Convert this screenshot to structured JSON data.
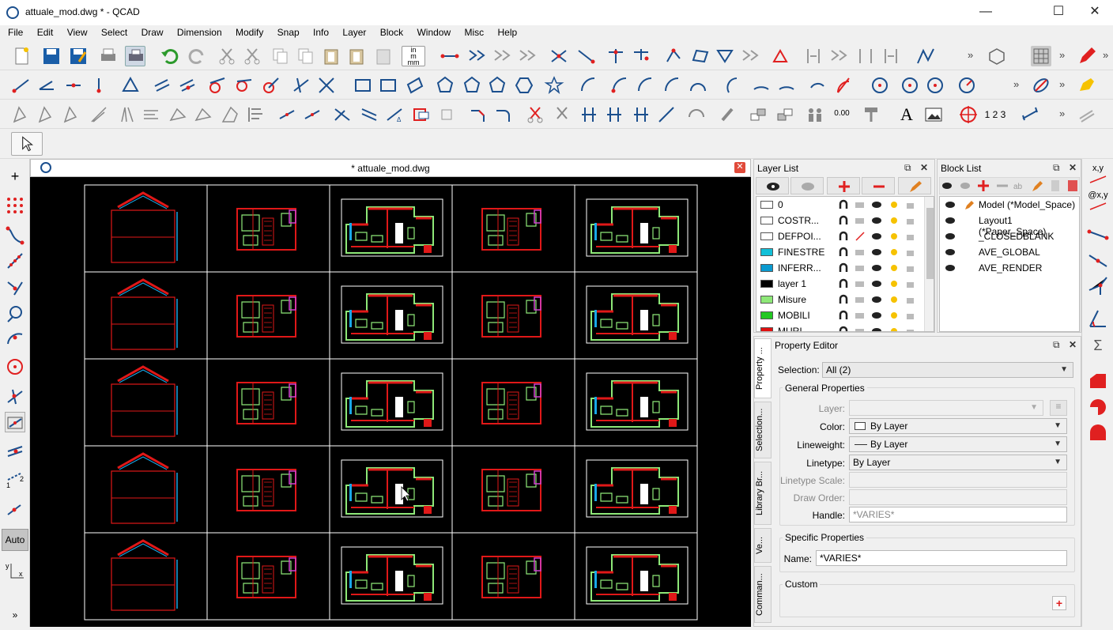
{
  "window": {
    "title": "attuale_mod.dwg * - QCAD",
    "minimize": "—",
    "maximize": "☐",
    "close": "✕"
  },
  "menu": [
    "File",
    "Edit",
    "View",
    "Select",
    "Draw",
    "Dimension",
    "Modify",
    "Snap",
    "Info",
    "Layer",
    "Block",
    "Window",
    "Misc",
    "Help"
  ],
  "document": {
    "title": "* attuale_mod.dwg",
    "close": "✕"
  },
  "left_tools": {
    "auto_label": "Auto"
  },
  "toolbar": {
    "unit_label": "in\nm\nmm",
    "dimension_value": "0.00",
    "text_tool": "A",
    "numbers_glyph": "1 2 3"
  },
  "layer_list": {
    "title": "Layer List",
    "layers": [
      {
        "name": "0",
        "color": "#ffffff"
      },
      {
        "name": "COSTR...",
        "color": "#ffffff"
      },
      {
        "name": "DEFPOI...",
        "color": "#ffffff"
      },
      {
        "name": "FINESTRE",
        "color": "#12c0d8"
      },
      {
        "name": "INFERR...",
        "color": "#0a9ad0"
      },
      {
        "name": "layer 1",
        "color": "#000000"
      },
      {
        "name": "Misure",
        "color": "#8ee878"
      },
      {
        "name": "MOBILI",
        "color": "#22c822"
      },
      {
        "name": "MURI",
        "color": "#e01010"
      }
    ]
  },
  "block_list": {
    "title": "Block List",
    "blocks": [
      "Model (*Model_Space)",
      "Layout1 (*Paper_Space)",
      "_CLOSEDBLANK",
      "AVE_GLOBAL",
      "AVE_RENDER"
    ]
  },
  "property_editor": {
    "title": "Property Editor",
    "tabs": [
      "Property ...",
      "Selection...",
      "Library Br...",
      "Ve...",
      "Comman..."
    ],
    "selection_label": "Selection:",
    "selection_value": "All (2)",
    "general_group": "General Properties",
    "layer_label": "Layer:",
    "layer_value": "",
    "color_label": "Color:",
    "color_value": "By Layer",
    "lineweight_label": "Lineweight:",
    "lineweight_value": "By Layer",
    "linetype_label": "Linetype:",
    "linetype_value": "By Layer",
    "linetype_scale_label": "Linetype Scale:",
    "draw_order_label": "Draw Order:",
    "handle_label": "Handle:",
    "handle_value": "*VARIES*",
    "specific_group": "Specific Properties",
    "name_label": "Name:",
    "name_value": "*VARIES*",
    "custom_group": "Custom"
  },
  "right_tools": {
    "xy": "x,y",
    "at_xy": "@x,y",
    "sigma": "Σ"
  },
  "colors": {
    "canvas_bg": "#000000",
    "frame_line": "#ffffff",
    "wall_red": "#e01818",
    "furniture_green": "#8ee878",
    "window_blue": "#18a8e8",
    "accent_magenta": "#d040d0"
  }
}
